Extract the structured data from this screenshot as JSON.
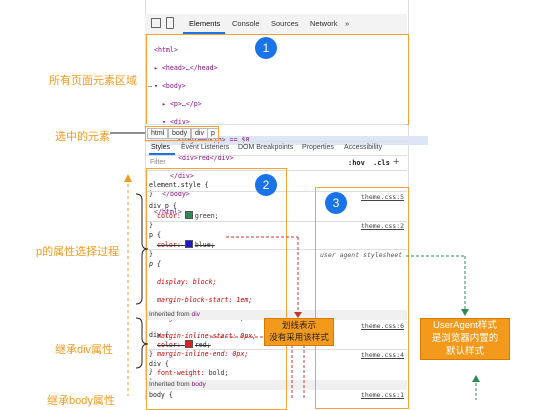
{
  "toolbar": {
    "tabs": [
      "Elements",
      "Console",
      "Sources",
      "Network",
      "»"
    ]
  },
  "dom_tree": {
    "lines": [
      "<html>",
      "▸ <head>…</head>",
      "▾ <body>",
      "▸ <p>…</p>",
      "▾ <div>",
      "<p>green</p> == $0",
      "<div>red</div>",
      "</div>",
      "</body>",
      "</html>"
    ]
  },
  "breadcrumb": [
    "html",
    "body",
    "div",
    "p"
  ],
  "styles_tabs": [
    "Styles",
    "Event Listeners",
    "DOM Breakpoints",
    "Properties",
    "Accessibility"
  ],
  "filter": {
    "placeholder": "Filter",
    "hov": ":hov",
    "cls": ".cls",
    "plus": "+"
  },
  "rules": {
    "element_style": {
      "selector": "element.style {",
      "close": "}"
    },
    "div_p": {
      "selector": "div p {",
      "prop": "color:",
      "value": "green;",
      "close": "}",
      "source": "theme.css:5",
      "swatch": "#2e8b57"
    },
    "p_blue": {
      "selector": "p {",
      "prop": "color:",
      "value": "blue;",
      "close": "}",
      "source": "theme.css:2",
      "swatch": "#1a1acc"
    },
    "p_ua": {
      "selector": "p {",
      "source": "user agent stylesheet",
      "props": [
        "display: block;",
        "margin-block-start: 1em;",
        "margin-block-end: 1em;",
        "margin-inline-start: 0px;",
        "margin-inline-end: 0px;"
      ],
      "close": "}"
    },
    "inherited_div": {
      "prefix": "Inherited from",
      "tag": "div"
    },
    "div_red": {
      "selector": "div {",
      "prop": "color:",
      "value": "red;",
      "close": "}",
      "source": "theme.css:6",
      "swatch": "#e02020"
    },
    "div_bold": {
      "selector": "div {",
      "prop": "font-weight:",
      "value": "bold;",
      "close": "}",
      "source": "theme.css:4"
    },
    "inherited_body": {
      "prefix": "Inherited from",
      "tag": "body"
    },
    "body": {
      "selector": "body {",
      "source": "theme.css:1"
    }
  },
  "annotations": {
    "page_elements": "所有页面元素区域",
    "selected_element": "选中的元素",
    "p_selector_process": "p的属性选择过程",
    "inherit_div": "继承div属性",
    "inherit_body": "继承body属性",
    "strike_callout": [
      "划线表示",
      "没有采用该样式"
    ],
    "ua_callout": [
      "UserAgent样式",
      "是浏览器内置的",
      "默认样式"
    ],
    "badges": [
      "1",
      "2",
      "3"
    ]
  },
  "colors": {
    "accent_orange": "#f39a1c",
    "badge_blue": "#1a73e8",
    "ua_green": "#2e8b57",
    "strike_red": "#c0392b"
  }
}
